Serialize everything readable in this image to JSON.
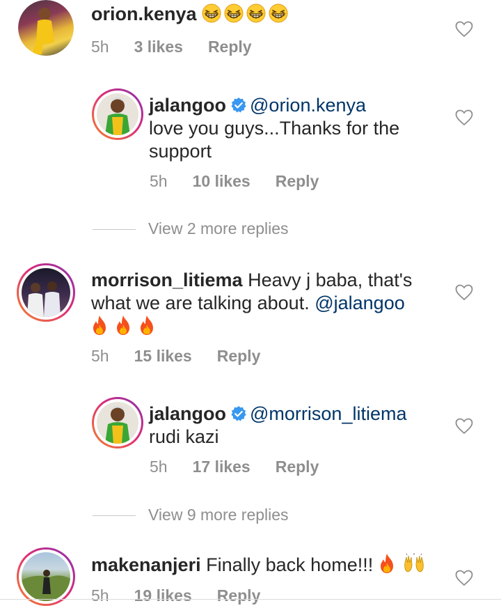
{
  "comments": [
    {
      "username": "orion.kenya",
      "body": "",
      "emojis": [
        "grin-squint-emoji",
        "grin-squint-emoji",
        "grin-squint-emoji",
        "grin-squint-emoji"
      ],
      "time": "5h",
      "likes": "3 likes",
      "reply": "Reply"
    },
    {
      "username": "jalangoo",
      "verified": true,
      "mention": "@orion.kenya",
      "body_line1": "love you guys...Thanks for the",
      "body_line2": "support",
      "time": "5h",
      "likes": "10 likes",
      "reply": "Reply"
    },
    {
      "view_more": "View 2 more replies"
    },
    {
      "username": "morrison_litiema",
      "body_line1": "Heavy j baba, that's",
      "body_line2": "what we are talking about.",
      "mention": "@jalangoo",
      "emojis": [
        "fire-emoji",
        "fire-emoji",
        "fire-emoji"
      ],
      "time": "5h",
      "likes": "15 likes",
      "reply": "Reply"
    },
    {
      "username": "jalangoo",
      "verified": true,
      "mention": "@morrison_litiema",
      "body_line1": "rudi kazi",
      "time": "5h",
      "likes": "17 likes",
      "reply": "Reply"
    },
    {
      "view_more": "View 9 more replies"
    },
    {
      "username": "makenanjeri",
      "body": "Finally back home!!!",
      "emojis": [
        "fire-emoji",
        "raising-hands-emoji"
      ],
      "time": "5h",
      "likes": "19 likes",
      "reply": "Reply"
    }
  ],
  "colors": {
    "text": "#262626",
    "meta": "#8e8e8e",
    "mention": "#003569",
    "verified": "#3897f0",
    "story_ring_start": "#f58529",
    "story_ring_end": "#8134af"
  }
}
